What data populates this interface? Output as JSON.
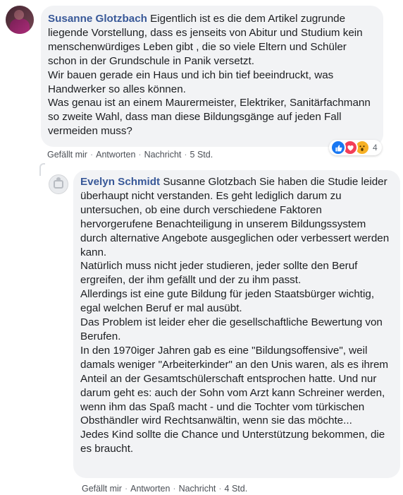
{
  "comments": [
    {
      "author": "Susanne Glotzbach",
      "text": " Eigentlich ist es die dem Artikel zugrunde liegende Vorstellung, dass es jenseits von Abitur und Studium kein menschenwürdiges Leben gibt , die so viele Eltern und Schüler schon in der Grundschule in Panik versetzt.\nWir bauen gerade ein Haus und ich bin tief beeindruckt, was Handwerker so alles können.\nWas genau ist an einem Maurermeister, Elektriker, Sanitärfachmann so zweite Wahl, dass man diese Bildungsgänge auf jeden Fall vermeiden muss?",
      "like_label": "Gefällt mir",
      "reply_label": "Antworten",
      "message_label": "Nachricht",
      "time": "5 Std.",
      "reaction_count": "4",
      "reaction_icons": [
        "like-icon",
        "love-icon",
        "wow-icon"
      ]
    },
    {
      "author": "Evelyn Schmidt",
      "text": " Susanne Glotzbach Sie haben die Studie leider überhaupt nicht verstanden. Es geht lediglich darum zu untersuchen, ob eine durch verschiedene Faktoren hervorgerufene Benachteiligung in unserem Bildungssystem durch alternative Angebote ausgeglichen oder verbessert werden kann.\nNatürlich muss nicht jeder studieren, jeder sollte den Beruf ergreifen, der ihm gefällt und der zu ihm passt.\nAllerdings ist eine gute Bildung für jeden Staatsbürger wichtig, egal welchen Beruf er mal ausübt.\nDas Problem ist leider eher die gesellschaftliche Bewertung von Berufen.\nIn den 1970iger Jahren gab es eine \"Bildungsoffensive\", weil damals weniger \"Arbeiterkinder\" an den Unis waren, als es ihrem Anteil an der Gesamtschülerschaft entsprochen hatte. Und nur darum geht es: auch der Sohn vom Arzt kann Schreiner werden, wenn ihm das Spaß macht - und die Tochter vom türkischen Obsthändler wird Rechtsanwältin, wenn sie das möchte...\nJedes Kind sollte die Chance und Unterstützung bekommen, die es braucht.",
      "like_label": "Gefällt mir",
      "reply_label": "Antworten",
      "message_label": "Nachricht",
      "time": "4 Std."
    }
  ],
  "colors": {
    "author": "#385898",
    "bubble": "#f2f3f5",
    "meta": "#606770",
    "like": "#1877f2",
    "love": "#f33e58",
    "wow": "#f7b125"
  }
}
